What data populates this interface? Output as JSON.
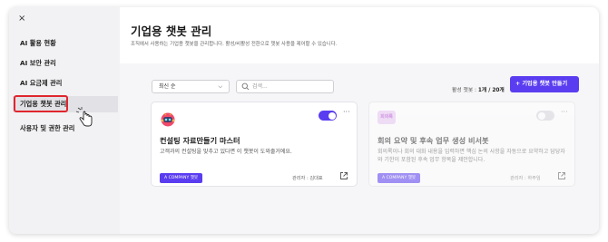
{
  "sidebar": {
    "close_icon": "×",
    "items": [
      {
        "label": "AI 활용 현황"
      },
      {
        "label": "AI 보안 관리"
      },
      {
        "label": "AI 요금제 관리"
      },
      {
        "label": "기업용 챗봇 관리"
      },
      {
        "label": "사용자 및 권한 관리"
      }
    ]
  },
  "main": {
    "title": "기업용 챗봇 관리",
    "description": "조직에서 사용하는 기업용 챗봇을 관리합니다. 활성/비활성 전환으로 챗봇 사용을 제어할 수 있습니다."
  },
  "toolbar": {
    "sort_value": "최신 순",
    "search_placeholder": "검색...",
    "active_label": "활성 챗봇 : ",
    "active_count": "1개 / 20개",
    "create_button": "+  기업용 챗봇 만들기"
  },
  "cards": [
    {
      "title": "컨설팅 자료만들기 마스터",
      "description": "고객과의 컨설팅을 맞추고 있다면 이 챗봇이 도와줄거에요.",
      "badge": "A COMPANY 챗봇",
      "manager": "관리자 : 김대표",
      "enabled": true
    },
    {
      "avatar_text": "회의록",
      "title": "회의 요약 및 후속 업무 생성 비서봇",
      "description": "회의록이나 회의 대화 내용을 입력하면 핵심 논의 사항을 자동으로 요약하고 담당자와 기한이 포함된 후속 업무 항목을 제안합니다.",
      "badge": "A COMPANY 챗봇",
      "manager": "관리자 : 하주임",
      "enabled": false
    }
  ],
  "colors": {
    "accent": "#5a3df0",
    "highlight": "#e0262e"
  }
}
